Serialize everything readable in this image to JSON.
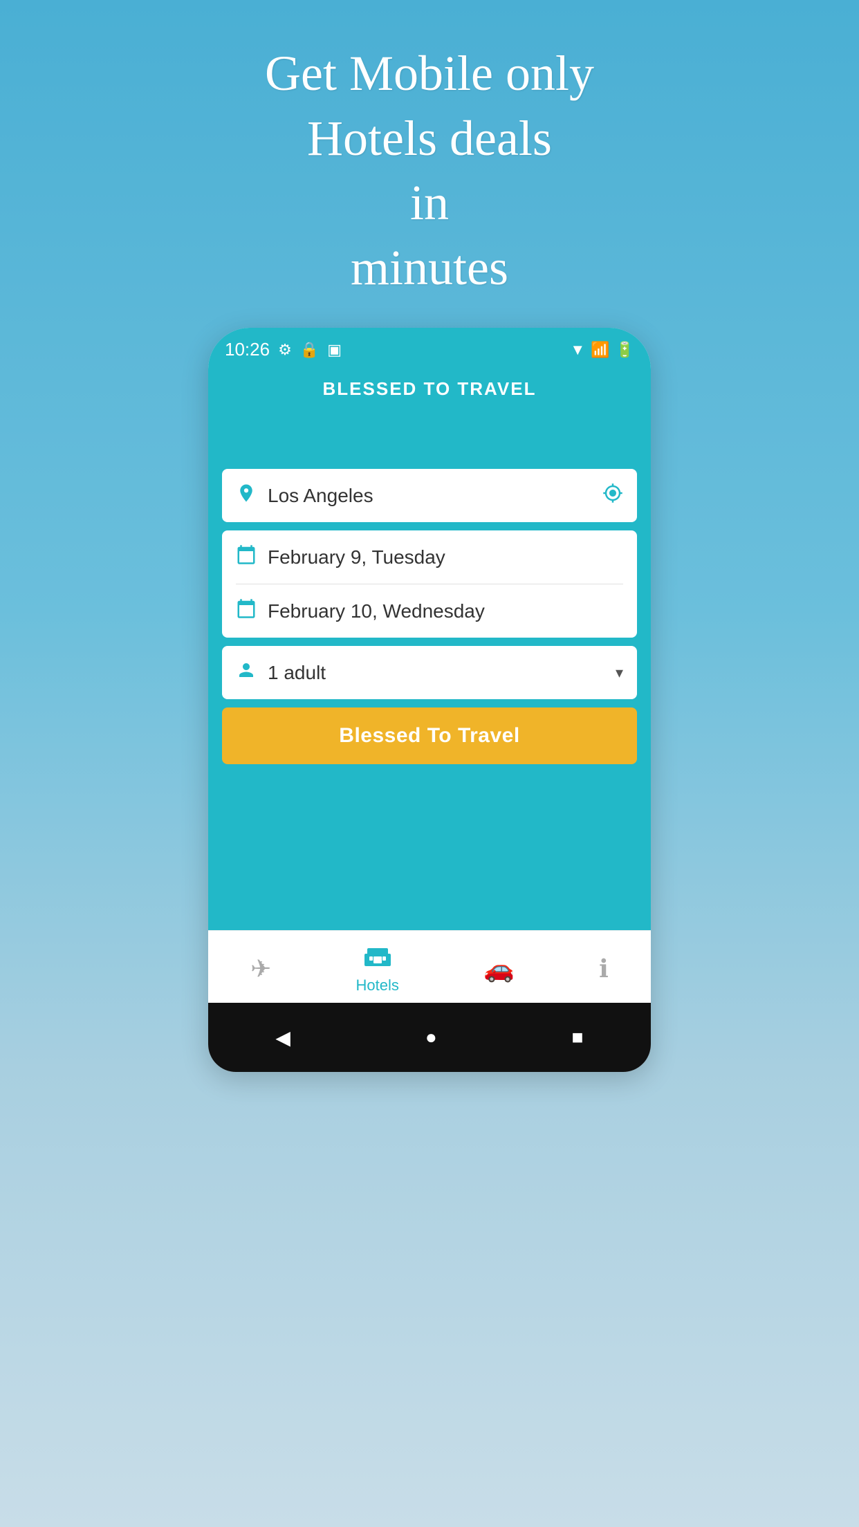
{
  "promo": {
    "line1": "Get Mobile only",
    "line2": "Hotels deals",
    "line3": "in",
    "line4": "minutes"
  },
  "statusBar": {
    "time": "10:26",
    "icons": [
      "⚙",
      "🔒",
      "▣"
    ]
  },
  "appTitle": "BLESSED TO TRAVEL",
  "locationField": {
    "placeholder": "Los Angeles",
    "value": "Los Angeles"
  },
  "checkIn": {
    "date": "February 9, Tuesday"
  },
  "checkOut": {
    "date": "February 10, Wednesday"
  },
  "guests": {
    "value": "1 adult"
  },
  "searchButton": {
    "label": "Blessed To Travel"
  },
  "bottomNav": {
    "items": [
      {
        "icon": "✈",
        "label": "",
        "active": false,
        "name": "flights"
      },
      {
        "icon": "🛏",
        "label": "Hotels",
        "active": true,
        "name": "hotels"
      },
      {
        "icon": "🚗",
        "label": "",
        "active": false,
        "name": "cars"
      },
      {
        "icon": "ℹ",
        "label": "",
        "active": false,
        "name": "info"
      }
    ]
  },
  "androidNav": {
    "back": "◀",
    "home": "●",
    "recents": "■"
  },
  "colors": {
    "teal": "#22b8c8",
    "yellow": "#f0b429",
    "bgGradientTop": "#4aafd4",
    "bgGradientBottom": "#c8dde8"
  }
}
